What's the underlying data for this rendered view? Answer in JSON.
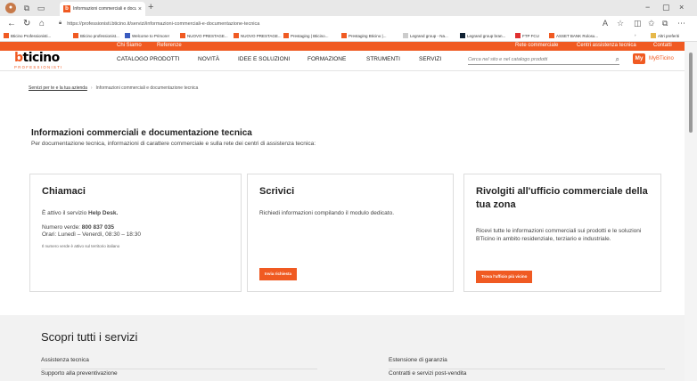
{
  "browser": {
    "tab_title": "Informazioni commerciali e docum",
    "tab_close": "×",
    "new_tab": "+",
    "url": "https://professionisti.bticino.it/servizi/informazioni-commerciali-e-documentazione-tecnica",
    "window_controls": [
      "−",
      "▢",
      "×"
    ],
    "favorites": [
      "Bticino Professionisti...",
      "Bticino professionist...",
      "Welcome to Primore!",
      "NUOVO PRESTAGE...",
      "NUOVO PRESTAGE...",
      "Prestaging | Bticino...",
      "Prestaging Bticino |...",
      "Legrand group - Na...",
      "Legrand group bran...",
      "FTP FCU",
      "ASSET BANK Rolosu..."
    ],
    "other_favorites": "Altri preferiti"
  },
  "topbar": {
    "left": [
      "Chi Siamo",
      "Referenze"
    ],
    "right": [
      "Rete commerciale",
      "Centri assistenza tecnica",
      "Contatti"
    ]
  },
  "logo": {
    "main_a": "b",
    "main_b": "ticino",
    "sub": "PROFESSIONISTI"
  },
  "menu": [
    "CATALOGO PRODOTTI",
    "NOVITÀ",
    "IDEE E SOLUZIONI",
    "FORMAZIONE",
    "STRUMENTI",
    "SERVIZI"
  ],
  "search": {
    "placeholder": "Cerca nel sito e nel catalogo prodotti"
  },
  "my": {
    "badge": "My",
    "label": "MyBTicino"
  },
  "breadcrumb": {
    "parent": "Servizi per te e la tua azienda",
    "sep": "›",
    "current": "Informazioni commerciali e documentazione tecnica"
  },
  "page": {
    "title": "Informazioni commerciali e documentazione tecnica",
    "subtitle": "Per documentazione tecnica, informazioni di carattere commerciale e sulla rete dei centri di assistenza tecnica:"
  },
  "cards": {
    "chiamaci": {
      "title": "Chiamaci",
      "line1_pre": "È attivo il servizio ",
      "line1_bold": "Help Desk.",
      "line2_pre": "Numero verde: ",
      "line2_bold": "800 837 035",
      "line3": "Orari: Lunedì – Venerdì, 08:30 – 18:30",
      "note": "Il numero verde è attivo sul territorio italiano"
    },
    "scrivici": {
      "title": "Scrivici",
      "text": "Richiedi informazioni compilando il modulo dedicato.",
      "button": "Invia richiesta"
    },
    "ufficio": {
      "title": "Rivolgiti all'ufficio commerciale della tua zona",
      "text": "Ricevi tutte le informazioni commerciali sui prodotti e le soluzioni BTicino in ambito residenziale, terziario e industriale.",
      "button": "Trova l'ufficio più vicino"
    }
  },
  "services": {
    "title": "Scopri tutti i servizi",
    "items": [
      "Assistenza tecnica",
      "Estensione di garanzia",
      "Supporto alla preventivazione",
      "Contratti e servizi post-vendita"
    ]
  },
  "colors": {
    "accent": "#f05a22"
  }
}
